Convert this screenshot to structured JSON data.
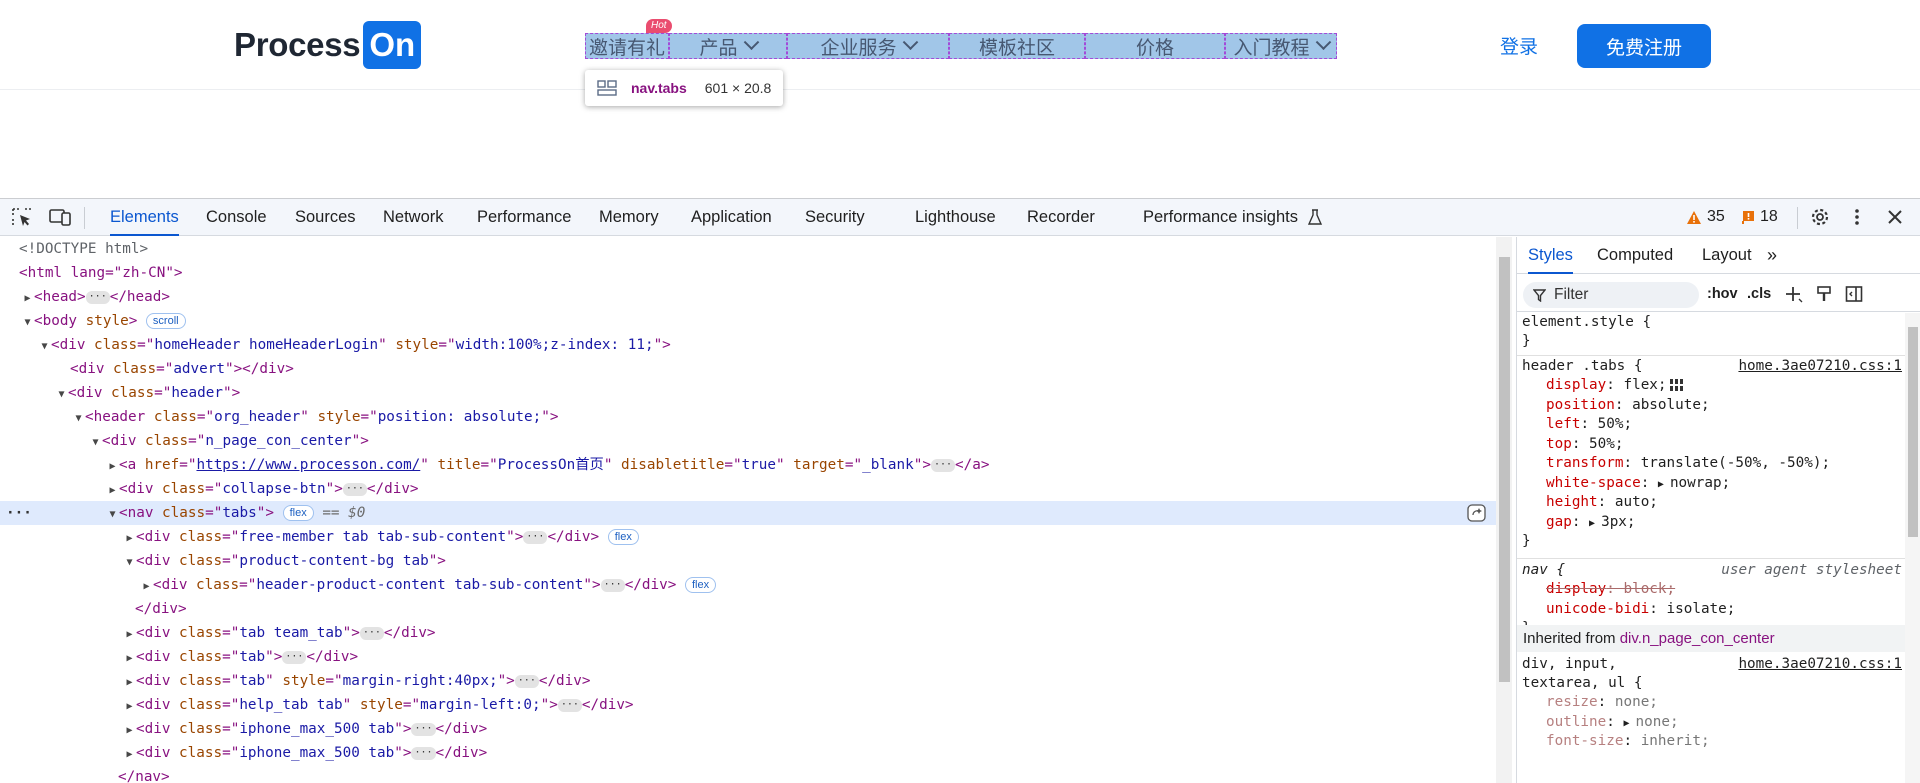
{
  "site": {
    "logo_text": "Process",
    "logo_box_text": "On",
    "hot_badge": "Hot",
    "nav_tabs": [
      {
        "label": "邀请有礼",
        "chevron": false,
        "width": 84
      },
      {
        "label": "产品",
        "chevron": true,
        "width": 118
      },
      {
        "label": "企业服务",
        "chevron": true,
        "width": 162
      },
      {
        "label": "模板社区",
        "chevron": false,
        "width": 136
      },
      {
        "label": "价格",
        "chevron": false,
        "width": 140
      },
      {
        "label": "入门教程",
        "chevron": true,
        "width": 112
      }
    ],
    "inspector_tooltip": {
      "name": "nav.tabs",
      "size": "601 × 20.8"
    },
    "login": "登录",
    "register": "免费注册",
    "colors": {
      "brand": "#1071e5",
      "hot": "#ea4d6f"
    }
  },
  "devtools": {
    "tabs": [
      "Elements",
      "Console",
      "Sources",
      "Network",
      "Performance",
      "Memory",
      "Application",
      "Security",
      "Lighthouse",
      "Recorder",
      "Performance insights"
    ],
    "active_tab": "Elements",
    "warnings_count": "35",
    "issues_count": "18",
    "side_tabs": [
      "Styles",
      "Computed",
      "Layout"
    ],
    "filter_placeholder": "Filter",
    "hov": ":hov",
    "cls": ".cls",
    "dom": {
      "doctype": "<!DOCTYPE html>",
      "html_open": "<html lang=\"zh-CN\">",
      "a_href": "https://www.processon.com/",
      "a_title": "ProcessOn首页",
      "dollar": "== $0",
      "scroll_badge": "scroll",
      "flex_badge": "flex"
    },
    "styles": {
      "element_style": "element.style {",
      "rule1_selector": "header .tabs {",
      "rule1_source": "home.3ae07210.css:1",
      "rule1_props": [
        [
          "display",
          "flex;"
        ],
        [
          "position",
          "absolute;"
        ],
        [
          "left",
          "50%;"
        ],
        [
          "top",
          "50%;"
        ],
        [
          "transform",
          "translate(-50%, -50%);"
        ],
        [
          "white-space",
          "nowrap;"
        ],
        [
          "height",
          "auto;"
        ],
        [
          "gap",
          "3px;"
        ]
      ],
      "rule2_selector": "nav {",
      "rule2_source": "user agent stylesheet",
      "rule2_props": [
        [
          "display",
          "block;"
        ],
        [
          "unicode-bidi",
          "isolate;"
        ]
      ],
      "inherited_label": "Inherited from",
      "inherited_from": "div.n_page_con_center",
      "rule3_selector_a": "div, input,",
      "rule3_selector_b": "textarea, ul {",
      "rule3_source": "home.3ae07210.css:1",
      "rule3_props": [
        [
          "resize",
          "none;"
        ],
        [
          "outline",
          "none;"
        ],
        [
          "font-size",
          "inherit;"
        ]
      ]
    }
  }
}
